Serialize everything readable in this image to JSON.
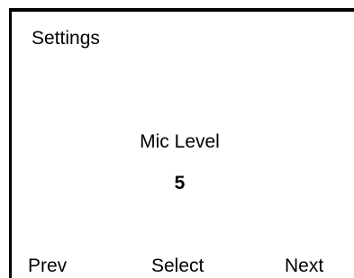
{
  "screen": {
    "title": "Settings",
    "setting": {
      "name": "Mic Level",
      "value": "5"
    }
  },
  "softkeys": {
    "left": "Prev",
    "center": "Select",
    "right": "Next"
  }
}
